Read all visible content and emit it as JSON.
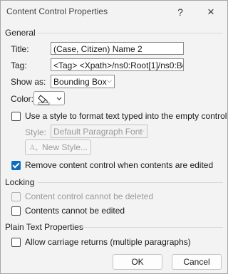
{
  "window": {
    "title": "Content Control Properties",
    "help_icon": "?",
    "close_icon": "×"
  },
  "general": {
    "section_label": "General",
    "title_label": "Title:",
    "title_value": "(Case, Citizen) Name 2",
    "tag_label": "Tag:",
    "tag_value": "<Tag> <Xpath>/ns0:Root[1]/ns0:Bo",
    "show_as_label": "Show as:",
    "show_as_value": "Bounding Box",
    "color_label": "Color:",
    "use_style_label": "Use a style to format text typed into the empty control",
    "use_style_checked": false,
    "style_label": "Style:",
    "style_value": "Default Paragraph Font",
    "new_style_label": "New Style...",
    "remove_control_label": "Remove content control when contents are edited",
    "remove_control_checked": true
  },
  "locking": {
    "section_label": "Locking",
    "cannot_delete_label": "Content control cannot be deleted",
    "cannot_delete_checked": false,
    "cannot_edit_label": "Contents cannot be edited",
    "cannot_edit_checked": false
  },
  "plain_text": {
    "section_label": "Plain Text Properties",
    "allow_returns_label": "Allow carriage returns (multiple paragraphs)",
    "allow_returns_checked": false
  },
  "buttons": {
    "ok": "OK",
    "cancel": "Cancel"
  },
  "colors": {
    "accent": "#0f6cbd",
    "dialog_bg": "#f3f3f3",
    "disabled_text": "#9a9a9a"
  }
}
